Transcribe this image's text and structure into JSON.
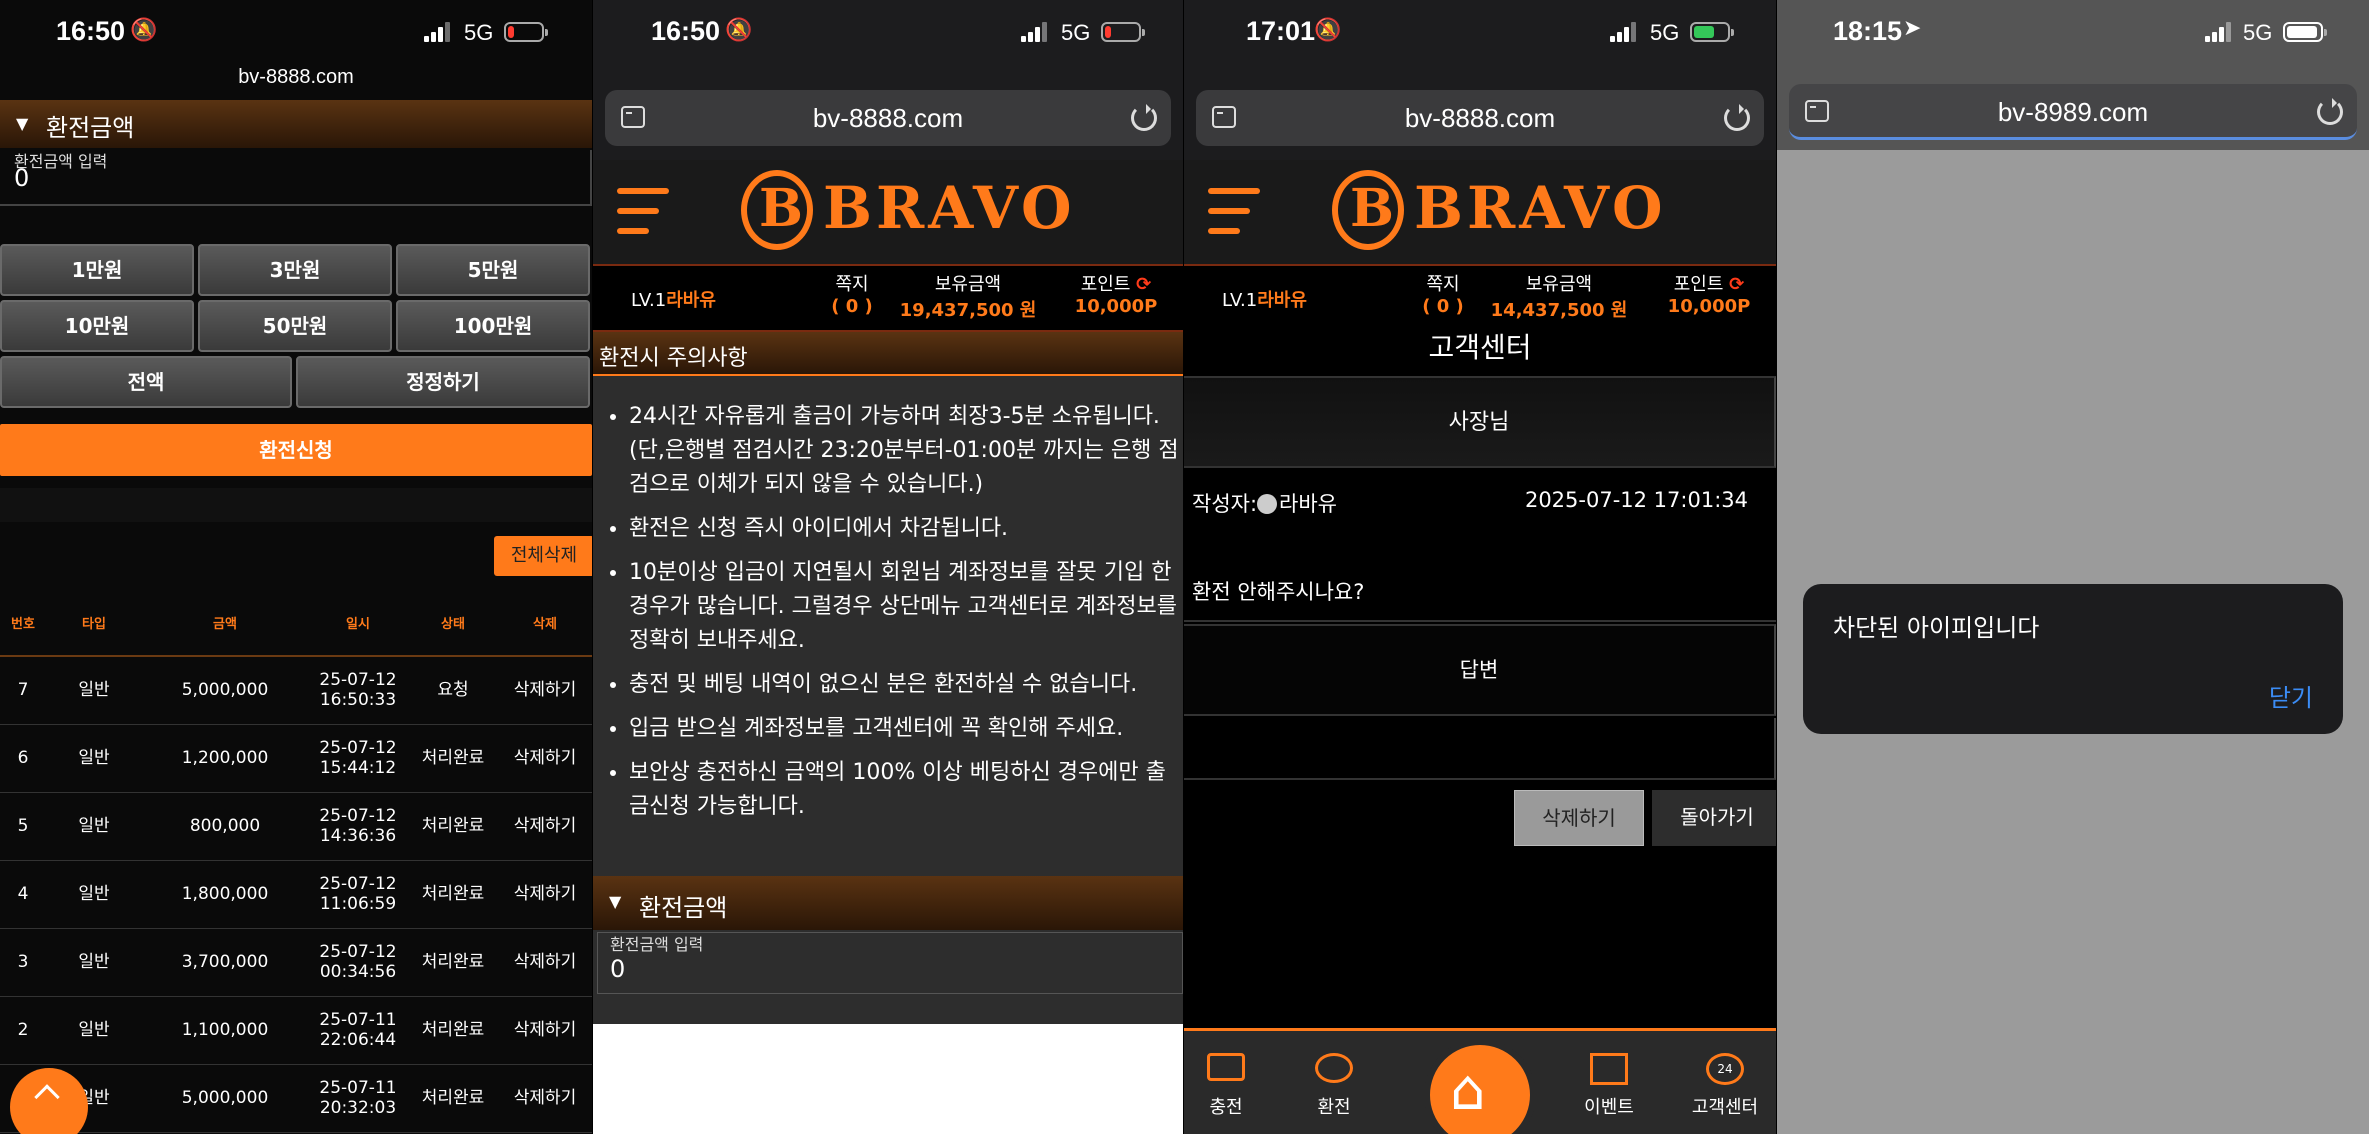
{
  "panel1": {
    "status": {
      "time": "16:50",
      "network": "5G"
    },
    "url": "bv-8888.com",
    "section_title": "환전금액",
    "amount_label": "환전금액 입력",
    "amount_value": "0",
    "amount_buttons": [
      "1만원",
      "3만원",
      "5만원",
      "10만원",
      "50만원",
      "100만원"
    ],
    "all_label": "전액",
    "correct_label": "정정하기",
    "submit_label": "환전신청",
    "delete_all_label": "전체삭제",
    "table_headers": [
      "번호",
      "타입",
      "금액",
      "일시",
      "상태",
      "삭제"
    ],
    "rows": [
      {
        "no": "7",
        "type": "일반",
        "amount": "5,000,000",
        "date": "25-07-12",
        "time": "16:50:33",
        "status": "요청",
        "action": "삭제하기"
      },
      {
        "no": "6",
        "type": "일반",
        "amount": "1,200,000",
        "date": "25-07-12",
        "time": "15:44:12",
        "status": "처리완료",
        "action": "삭제하기"
      },
      {
        "no": "5",
        "type": "일반",
        "amount": "800,000",
        "date": "25-07-12",
        "time": "14:36:36",
        "status": "처리완료",
        "action": "삭제하기"
      },
      {
        "no": "4",
        "type": "일반",
        "amount": "1,800,000",
        "date": "25-07-12",
        "time": "11:06:59",
        "status": "처리완료",
        "action": "삭제하기"
      },
      {
        "no": "3",
        "type": "일반",
        "amount": "3,700,000",
        "date": "25-07-12",
        "time": "00:34:56",
        "status": "처리완료",
        "action": "삭제하기"
      },
      {
        "no": "2",
        "type": "일반",
        "amount": "1,100,000",
        "date": "25-07-11",
        "time": "22:06:44",
        "status": "처리완료",
        "action": "삭제하기"
      },
      {
        "no": "1",
        "type": "일반",
        "amount": "5,000,000",
        "date": "25-07-11",
        "time": "20:32:03",
        "status": "처리완료",
        "action": "삭제하기"
      }
    ]
  },
  "panel2": {
    "status": {
      "time": "16:50",
      "network": "5G"
    },
    "url": "bv-8888.com",
    "logo": "BRAVO",
    "level": "LV.1",
    "username": "라바유",
    "note_label": "쪽지",
    "note_value": "( 0 )",
    "balance_label": "보유금액",
    "balance_value": "19,437,500 원",
    "point_label": "포인트",
    "point_value": "10,000P",
    "notice_title": "환전시 주의사항",
    "notices": [
      "24시간 자유롭게 출금이 가능하며 최장3-5분 소유됩니다. (단,은행별 점검시간 23:20분부터-01:00분 까지는 은행 점검으로 이체가 되지 않을 수 있습니다.)",
      "환전은 신청 즉시 아이디에서 차감됩니다.",
      "10분이상 입금이 지연될시 회원님 계좌정보를 잘못 기입 한 경우가 많습니다. 그럴경우 상단메뉴 고객센터로 계좌정보를 정확히 보내주세요.",
      "충전 및 베팅 내역이 없으신 분은 환전하실 수 없습니다.",
      "입금 받으실 계좌정보를 고객센터에 꼭 확인해 주세요.",
      "보안상 충전하신 금액의 100% 이상 베팅하신 경우에만 출금신청 가능합니다."
    ],
    "section_title": "환전금액",
    "amount_label": "환전금액 입력",
    "amount_value": "0"
  },
  "panel3": {
    "status": {
      "time": "17:01",
      "network": "5G"
    },
    "url": "bv-8888.com",
    "logo": "BRAVO",
    "level": "LV.1",
    "username": "라바유",
    "note_label": "쪽지",
    "note_value": "( 0 )",
    "balance_label": "보유금액",
    "balance_value": "14,437,500 원",
    "point_label": "포인트",
    "point_value": "10,000P",
    "page_title": "고객센터",
    "post_title": "사장님",
    "author_label": "작성자:",
    "author": "라바유",
    "post_date": "2025-07-12 17:01:34",
    "post_body": "환전 안해주시나요?",
    "answer_label": "답변",
    "delete_label": "삭제하기",
    "back_label": "돌아가기",
    "nav": [
      "충전",
      "환전",
      "이벤트",
      "고객센터"
    ]
  },
  "panel4": {
    "status": {
      "time": "18:15",
      "network": "5G"
    },
    "url": "bv-8989.com",
    "alert_message": "차단된 아이피입니다",
    "alert_close": "닫기"
  },
  "colors": {
    "accent": "#ff7a1a",
    "link_blue": "#3b8cf5",
    "panel_bg": "#000000"
  }
}
